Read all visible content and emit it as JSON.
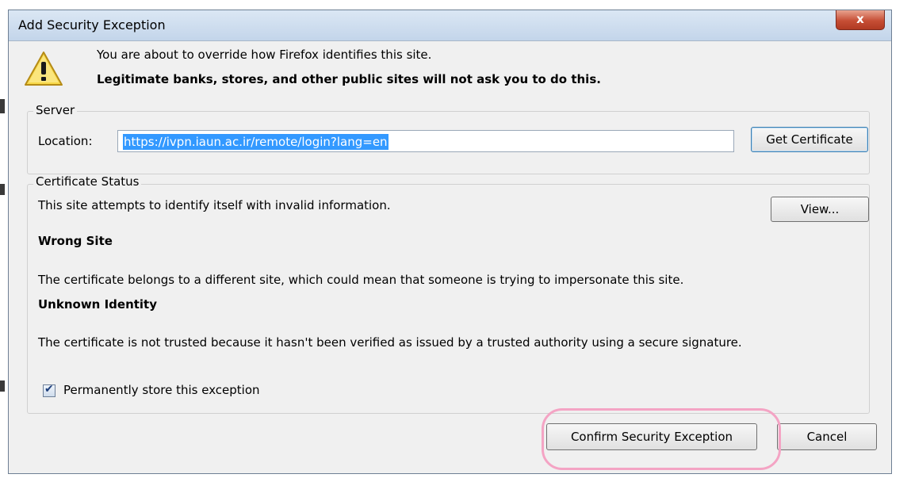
{
  "dialog": {
    "title": "Add Security Exception",
    "close_glyph": "x",
    "message_line1": "You are about to override how Firefox identifies this site.",
    "message_line2": "Legitimate banks, stores, and other public sites will not ask you to do this."
  },
  "server": {
    "legend": "Server",
    "location_label": "Location:",
    "location_value": "https://ivpn.iaun.ac.ir/remote/login?lang=en",
    "get_certificate_label": "Get Certificate"
  },
  "certificate_status": {
    "legend": "Certificate Status",
    "description": "This site attempts to identify itself with invalid information.",
    "view_label": "View...",
    "wrong_site_heading": "Wrong Site",
    "wrong_site_text": "The certificate belongs to a different site, which could mean that someone is trying to impersonate this site.",
    "unknown_identity_heading": "Unknown Identity",
    "unknown_identity_text": "The certificate is not trusted because it hasn't been verified as issued by a trusted authority using a secure signature."
  },
  "permanent_store": {
    "label": "Permanently store this exception",
    "checked": true
  },
  "buttons": {
    "confirm_label": "Confirm Security Exception",
    "cancel_label": "Cancel"
  },
  "icons": {
    "warning": "warning-icon",
    "close": "close-icon",
    "checkbox": "checkbox-checked-icon"
  },
  "colors": {
    "selection": "#3399ff",
    "highlight_ring": "#f4a4c4",
    "close_button": "#c64e35"
  }
}
